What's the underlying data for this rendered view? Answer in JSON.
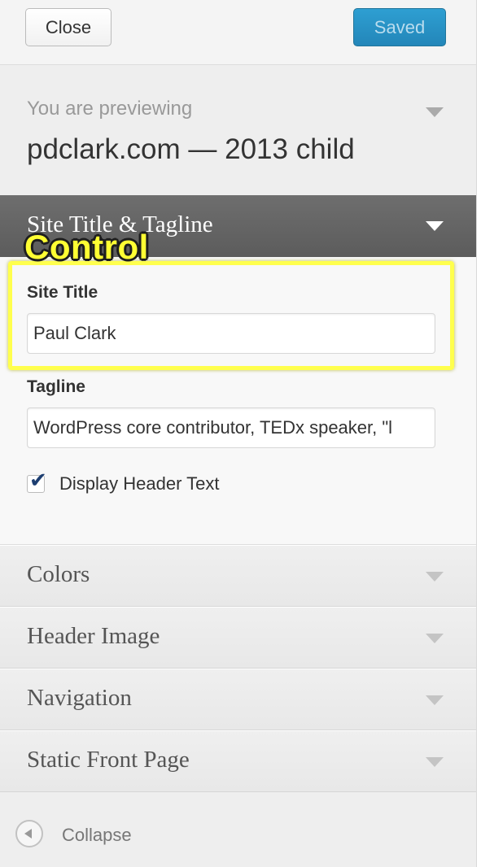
{
  "header": {
    "close_label": "Close",
    "saved_label": "Saved"
  },
  "preview": {
    "label": "You are previewing",
    "theme_name": "pdclark.com — 2013 child"
  },
  "active_section": {
    "title": "Site Title & Tagline",
    "site_title_label": "Site Title",
    "site_title_value": "Paul Clark",
    "tagline_label": "Tagline",
    "tagline_value": "WordPress core contributor, TEDx speaker, \"l",
    "display_header_text_label": "Display Header Text",
    "display_header_text_checked": true
  },
  "annotation": {
    "control_label": "Control",
    "highlight_color": "#ffff4d"
  },
  "sections": [
    {
      "title": "Colors"
    },
    {
      "title": "Header Image"
    },
    {
      "title": "Navigation"
    },
    {
      "title": "Static Front Page"
    }
  ],
  "footer": {
    "collapse_label": "Collapse"
  },
  "colors": {
    "saved_button": "#2386b9",
    "active_header": "#5c5c5c",
    "panel_bg": "#eeeeee"
  },
  "icons": {
    "section_toggle": "chevron-down-icon",
    "collapse": "collapse-left-icon",
    "checkbox": "checkmark-icon"
  }
}
